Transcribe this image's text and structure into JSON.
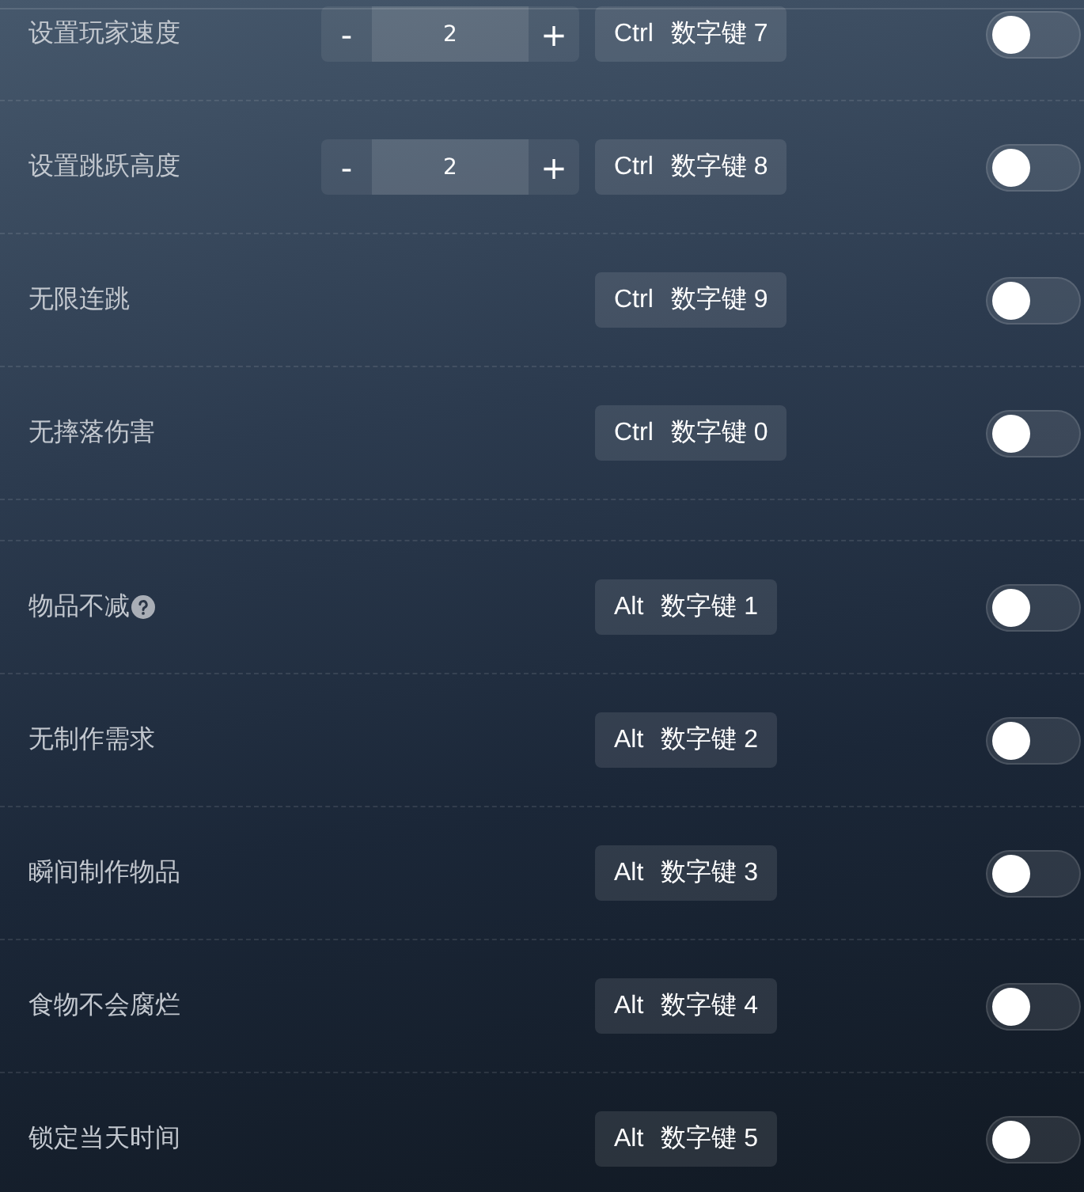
{
  "sections": [
    {
      "rows": [
        {
          "label": "设置玩家速度",
          "help": false,
          "stepper": {
            "minus": "-",
            "value": "2",
            "plus": "+"
          },
          "hotkey": {
            "modifier": "Ctrl",
            "key": "数字键 7"
          },
          "on": false
        },
        {
          "label": "设置跳跃高度",
          "help": false,
          "stepper": {
            "minus": "-",
            "value": "2",
            "plus": "+"
          },
          "hotkey": {
            "modifier": "Ctrl",
            "key": "数字键 8"
          },
          "on": false
        },
        {
          "label": "无限连跳",
          "help": false,
          "hotkey": {
            "modifier": "Ctrl",
            "key": "数字键 9"
          },
          "on": false
        },
        {
          "label": "无摔落伤害",
          "help": false,
          "hotkey": {
            "modifier": "Ctrl",
            "key": "数字键 0"
          },
          "on": false
        }
      ]
    },
    {
      "rows": [
        {
          "label": "物品不减",
          "help": true,
          "hotkey": {
            "modifier": "Alt",
            "key": "数字键 1"
          },
          "on": false
        },
        {
          "label": "无制作需求",
          "help": false,
          "hotkey": {
            "modifier": "Alt",
            "key": "数字键 2"
          },
          "on": false
        },
        {
          "label": "瞬间制作物品",
          "help": false,
          "hotkey": {
            "modifier": "Alt",
            "key": "数字键 3"
          },
          "on": false
        },
        {
          "label": "食物不会腐烂",
          "help": false,
          "hotkey": {
            "modifier": "Alt",
            "key": "数字键 4"
          },
          "on": false
        },
        {
          "label": "锁定当天时间",
          "help": false,
          "hotkey": {
            "modifier": "Alt",
            "key": "数字键 5"
          },
          "on": false
        }
      ]
    }
  ]
}
